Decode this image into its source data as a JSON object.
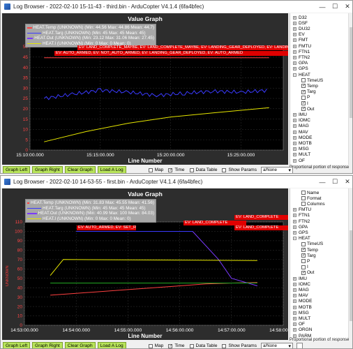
{
  "windows": [
    {
      "title": "Log Browser - 2022-02-10 15-11-43 - third.bin - ArduCopter V4.1.4 (6fa4bfec)",
      "graph_title": "Value Graph",
      "x_axis_title": "Line Number",
      "legend": [
        {
          "text": "HEAT.Temp (UNKNOWN)   (Min: 44.56 Max: 44.86 Mean: 44.7)",
          "color": "#ff4040"
        },
        {
          "text": "HEAT.Targ (UNKNOWN)   (Min: 45 Max: 45 Mean: 45)",
          "color": "#3a3aff"
        },
        {
          "text": "HEAT.Out (UNKNOWN)   (Min: 23.12 Max: 31.06 Mean: 27.45)",
          "color": "#7a3aff"
        },
        {
          "text": "HEAT.I (UNKNOWN)   (Min: 0 Max: 0 Mean: 0)",
          "color": "#e6e600"
        }
      ],
      "events": [
        "EV: LAND_COMPLETE_MAYBE, EV: LAND_COMPLETE_MAYBE, EV: LANDING_GEAR_DEPLOYED, EV: LANDING_GEAR_DEPLOYED",
        "EV: AUTO_ARMED, EV: NOT_AUTO_ARMED, EV: LANDING_GEAR_DEPLOYED, EV: AUTO_ARMED"
      ],
      "y_ticks": [
        "50",
        "45",
        "40",
        "35",
        "30",
        "25",
        "20",
        "15",
        "10",
        "5",
        "0"
      ],
      "x_ticks": [
        "15:10:00.000",
        "15:15:00.000",
        "15:20:00.000",
        "15:25:00.000"
      ],
      "tree": [
        {
          "label": "D32",
          "type": "exp"
        },
        {
          "label": "DSF",
          "type": "exp"
        },
        {
          "label": "DU32",
          "type": "exp"
        },
        {
          "label": "EV",
          "type": "exp"
        },
        {
          "label": "FMT",
          "type": "exp"
        },
        {
          "label": "FMTU",
          "type": "exp"
        },
        {
          "label": "FTN1",
          "type": "exp"
        },
        {
          "label": "FTN2",
          "type": "exp"
        },
        {
          "label": "GPA",
          "type": "exp"
        },
        {
          "label": "GPS",
          "type": "exp"
        },
        {
          "label": "HEAT",
          "type": "open"
        },
        {
          "label": "TimeUS",
          "type": "cb",
          "checked": false
        },
        {
          "label": "Temp",
          "type": "cb",
          "checked": true
        },
        {
          "label": "Targ",
          "type": "cb",
          "checked": true
        },
        {
          "label": "P",
          "type": "cb",
          "checked": false
        },
        {
          "label": "I",
          "type": "cb",
          "checked": true
        },
        {
          "label": "Out",
          "type": "cb",
          "checked": true
        },
        {
          "label": "IMU",
          "type": "exp"
        },
        {
          "label": "IOMC",
          "type": "exp"
        },
        {
          "label": "MAG",
          "type": "exp"
        },
        {
          "label": "MAV",
          "type": "exp"
        },
        {
          "label": "MODE",
          "type": "exp"
        },
        {
          "label": "MOTB",
          "type": "exp"
        },
        {
          "label": "MSG",
          "type": "exp"
        },
        {
          "label": "MULT",
          "type": "exp"
        },
        {
          "label": "OF",
          "type": "exp"
        }
      ],
      "proportional": "Proportional portion of response",
      "buttons": [
        "Graph Left",
        "Graph Right",
        "Clear Graph",
        "Load A Log"
      ],
      "checks": [
        {
          "label": "Map",
          "checked": false
        },
        {
          "label": "Time",
          "checked": true
        },
        {
          "label": "Data Table",
          "checked": false
        },
        {
          "label": "Show Params",
          "checked": false
        }
      ],
      "select": "a/None"
    },
    {
      "title": "Log Browser - 2022-02-10 14-53-55 - first.bin - ArduCopter V4.1.4 (6fa4bfec)",
      "graph_title": "Value Graph",
      "x_axis_title": "Line Number",
      "y_axis_label": "UNKNOWN",
      "legend": [
        {
          "text": "HEAT.Temp (UNKNOWN)   (Min: 31.83 Max: 45.55 Mean: 41.56)",
          "color": "#ff4040"
        },
        {
          "text": "HEAT.Targ (UNKNOWN)   (Min: 45 Max: 45 Mean: 45)",
          "color": "#3a3aff"
        },
        {
          "text": "HEAT.Out (UNKNOWN)   (Min: 40.99 Max: 100 Mean: 84.03)",
          "color": "#7a3aff"
        },
        {
          "text": "HEAT.I (UNKNOWN)   (Min: 0 Max: 0 Mean: 0)",
          "color": "#e6e600"
        }
      ],
      "events": [
        "EV: LAND_COMPLETE",
        "EV: AUTO_ARMED, EV: SET_RESET",
        "EV: LAND_COMPLETE",
        "EV: LAND_COMPLETE"
      ],
      "y_ticks": [
        "110",
        "100",
        "90",
        "80",
        "70",
        "60",
        "50",
        "40",
        "30",
        "20",
        "10",
        "0"
      ],
      "x_ticks": [
        "14:53:00.000",
        "14:54:00.000",
        "14:55:00.000",
        "14:56:00.000",
        "14:57:00.000",
        "14:58:00.000"
      ],
      "tree": [
        {
          "label": "Name",
          "type": "cb",
          "checked": false
        },
        {
          "label": "Format",
          "type": "cb",
          "checked": false
        },
        {
          "label": "Columns",
          "type": "cb",
          "checked": false
        },
        {
          "label": "FMTU",
          "type": "exp"
        },
        {
          "label": "FTN1",
          "type": "exp"
        },
        {
          "label": "FTN2",
          "type": "exp"
        },
        {
          "label": "GPA",
          "type": "exp"
        },
        {
          "label": "GPS",
          "type": "exp"
        },
        {
          "label": "HEAT",
          "type": "open"
        },
        {
          "label": "TimeUS",
          "type": "cb",
          "checked": false
        },
        {
          "label": "Temp",
          "type": "cb",
          "checked": true
        },
        {
          "label": "Targ",
          "type": "cb",
          "checked": true
        },
        {
          "label": "P",
          "type": "cb",
          "checked": false
        },
        {
          "label": "I",
          "type": "cb",
          "checked": false
        },
        {
          "label": "Out",
          "type": "cb",
          "checked": true
        },
        {
          "label": "IMU",
          "type": "exp"
        },
        {
          "label": "IOMC",
          "type": "exp"
        },
        {
          "label": "MAG",
          "type": "exp"
        },
        {
          "label": "MAV",
          "type": "exp"
        },
        {
          "label": "MODE",
          "type": "exp"
        },
        {
          "label": "MOTB",
          "type": "exp"
        },
        {
          "label": "MSG",
          "type": "exp"
        },
        {
          "label": "MULT",
          "type": "exp"
        },
        {
          "label": "OF",
          "type": "exp"
        },
        {
          "label": "ORGN",
          "type": "exp"
        },
        {
          "label": "PARM",
          "type": "exp"
        }
      ],
      "proportional": "Proportional portion of response",
      "buttons": [
        "Graph Left",
        "Graph Right",
        "Clear Graph",
        "Load A Log"
      ],
      "checks": [
        {
          "label": "Map",
          "checked": false
        },
        {
          "label": "Time",
          "checked": true
        },
        {
          "label": "Data Table",
          "checked": false
        },
        {
          "label": "Show Params",
          "checked": false
        }
      ],
      "select": "a/None"
    }
  ],
  "icons": {
    "minimize": "minimize-icon",
    "maximize": "maximize-icon",
    "close": "close-icon"
  },
  "chart_data": [
    {
      "type": "line",
      "title": "Value Graph",
      "xlabel": "Line Number",
      "ylabel": "",
      "ylim": [
        0,
        50
      ],
      "xlim": [
        "15:10:00",
        "15:28:00"
      ],
      "series": [
        {
          "name": "HEAT.Temp",
          "color": "#ff4040",
          "x": [
            "15:11:00",
            "15:27:00"
          ],
          "values": [
            44.7,
            44.7
          ]
        },
        {
          "name": "HEAT.Out",
          "color": "#3a3aff",
          "x": [
            "15:11:00",
            "15:13:00",
            "15:15:00",
            "15:17:00",
            "15:19:00",
            "15:21:00",
            "15:23:00",
            "15:25:00",
            "15:27:00"
          ],
          "values": [
            25,
            27,
            29,
            28,
            26.5,
            27.5,
            28.5,
            28,
            29
          ]
        },
        {
          "name": "HEAT.I",
          "color": "#e6e600",
          "x": [
            "15:11:00",
            "15:14:00",
            "15:17:00",
            "15:20:00",
            "15:23:00",
            "15:27:00"
          ],
          "values": [
            4,
            9,
            13,
            16,
            18,
            20.5
          ]
        }
      ]
    },
    {
      "type": "line",
      "title": "Value Graph",
      "xlabel": "Line Number",
      "ylabel": "UNKNOWN",
      "ylim": [
        0,
        110
      ],
      "xlim": [
        "14:53:00",
        "14:58:00"
      ],
      "series": [
        {
          "name": "HEAT.Temp",
          "color": "#ff4040",
          "x": [
            "14:53:30",
            "14:54:00",
            "14:55:00",
            "14:56:00",
            "14:56:30",
            "14:57:00",
            "14:57:30"
          ],
          "values": [
            32,
            34,
            38,
            42,
            44,
            45,
            45.5
          ]
        },
        {
          "name": "HEAT.Targ",
          "color": "#3a3aff",
          "x": [
            "14:54:00",
            "14:56:15"
          ],
          "values": [
            100,
            100
          ]
        },
        {
          "name": "HEAT.Out",
          "color": "#7a3aff",
          "x": [
            "14:56:15",
            "14:56:45",
            "14:57:00",
            "14:57:30"
          ],
          "values": [
            100,
            70,
            50,
            42
          ]
        },
        {
          "name": "HEAT.I",
          "color": "#e6e600",
          "x": [
            "14:53:30",
            "14:53:45",
            "14:57:30"
          ],
          "values": [
            53,
            70,
            69
          ]
        },
        {
          "name": "HEAT.Targ (flat)",
          "color": "#22aa22",
          "x": [
            "14:53:30",
            "14:57:30"
          ],
          "values": [
            45,
            45
          ]
        }
      ]
    }
  ]
}
